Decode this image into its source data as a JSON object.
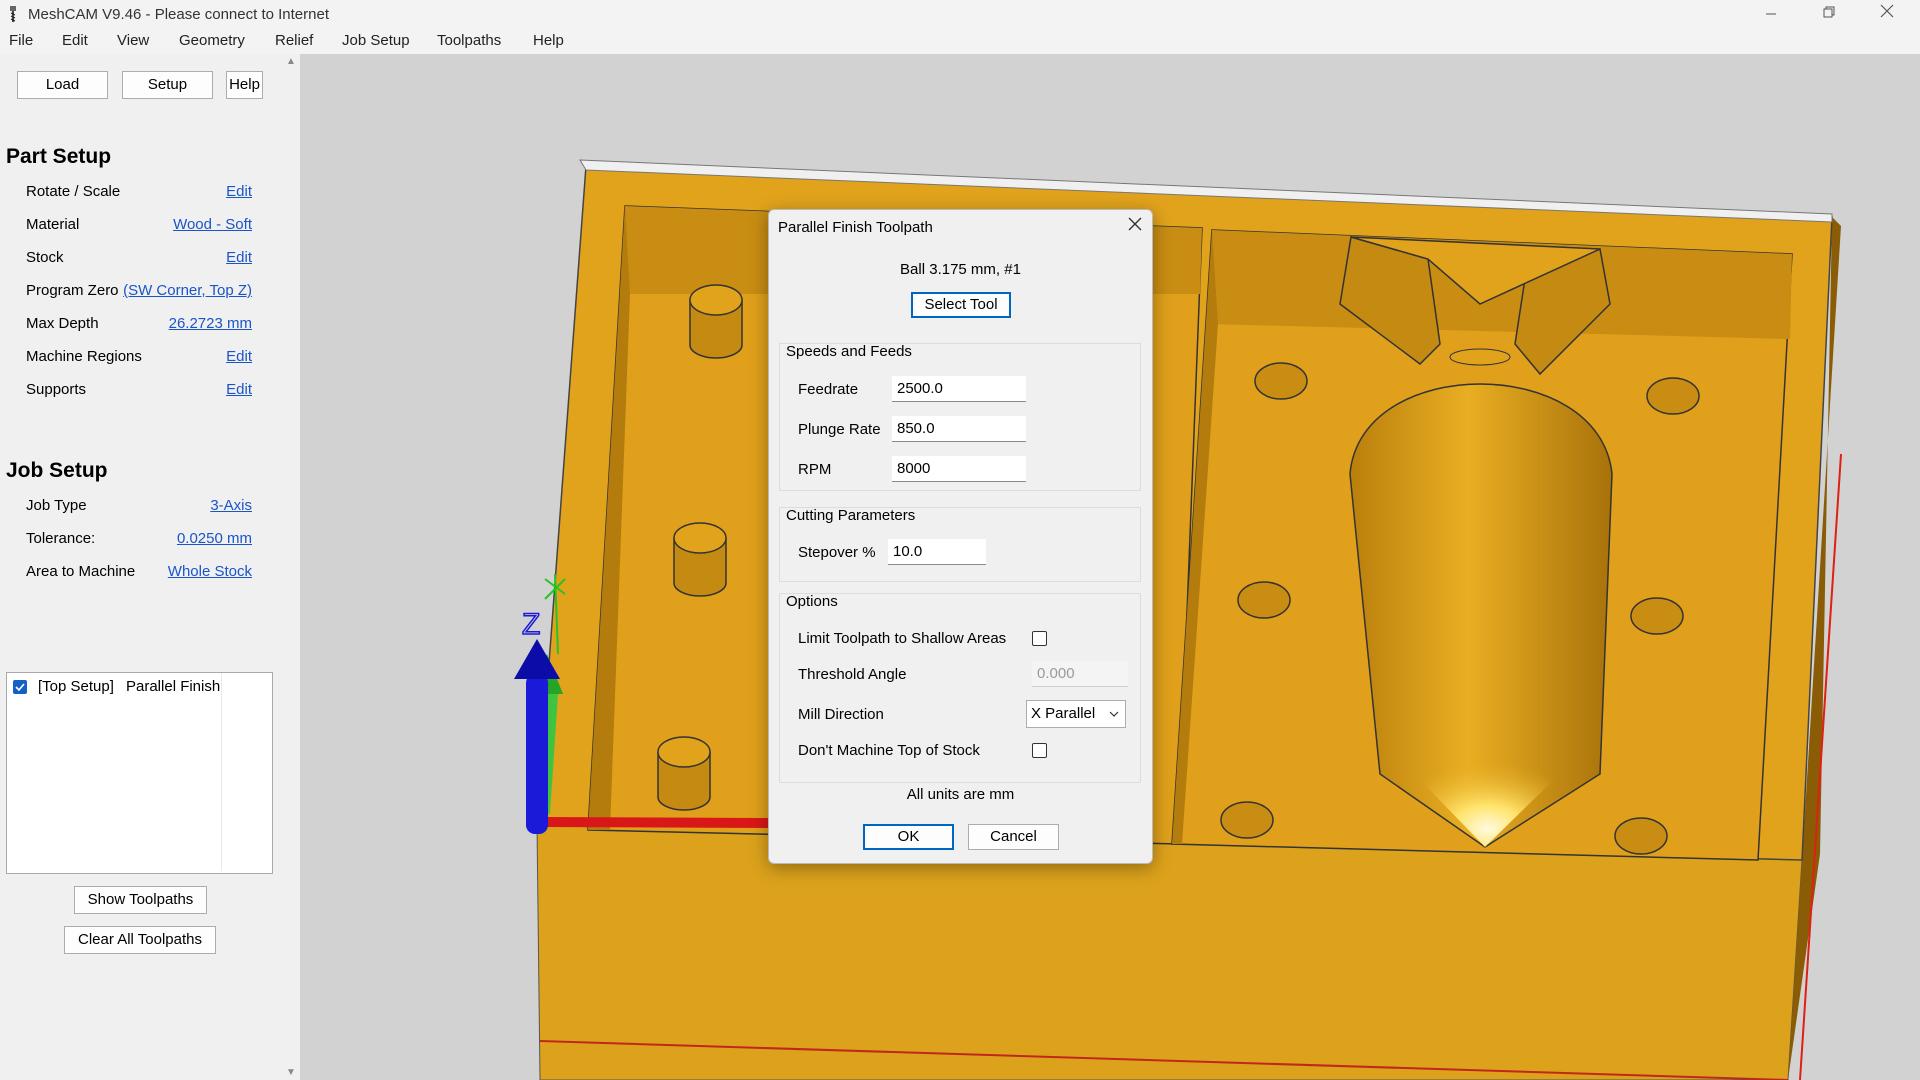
{
  "window": {
    "title": "MeshCAM V9.46 - Please connect to Internet"
  },
  "menu": [
    "File",
    "Edit",
    "View",
    "Geometry",
    "Relief",
    "Job Setup",
    "Toolpaths",
    "Help"
  ],
  "top_buttons": {
    "load": "Load",
    "setup": "Setup",
    "help": "Help"
  },
  "part_setup": {
    "heading": "Part Setup",
    "rows": [
      {
        "label": "Rotate / Scale",
        "value": "Edit"
      },
      {
        "label": "Material",
        "value": "Wood - Soft"
      },
      {
        "label": "Stock",
        "value": "Edit"
      },
      {
        "label": "Program Zero",
        "value": "(SW Corner, Top Z)"
      },
      {
        "label": "Max Depth",
        "value": "26.2723 mm"
      },
      {
        "label": "Machine Regions",
        "value": "Edit"
      },
      {
        "label": "Supports",
        "value": "Edit"
      }
    ]
  },
  "job_setup": {
    "heading": "Job Setup",
    "rows": [
      {
        "label": "Job Type",
        "value": "3-Axis"
      },
      {
        "label": "Tolerance:",
        "value": "0.0250 mm"
      },
      {
        "label": "Area to Machine",
        "value": "Whole Stock"
      }
    ]
  },
  "toolpath_list": [
    {
      "checked": true,
      "setup": "[Top Setup]",
      "name": "Parallel Finish"
    }
  ],
  "bottom_buttons": {
    "show": "Show Toolpaths",
    "clear": "Clear All Toolpaths"
  },
  "viewport": {
    "axis_label": "Z"
  },
  "dialog": {
    "title": "Parallel Finish Toolpath",
    "tool": "Ball 3.175 mm, #1",
    "select_tool": "Select Tool",
    "speeds": {
      "label": "Speeds and Feeds",
      "feedrate_label": "Feedrate",
      "feedrate": "2500.0",
      "plunge_label": "Plunge Rate",
      "plunge": "850.0",
      "rpm_label": "RPM",
      "rpm": "8000"
    },
    "cutting": {
      "label": "Cutting Parameters",
      "stepover_label": "Stepover %",
      "stepover": "10.0"
    },
    "options": {
      "label": "Options",
      "limit_label": "Limit Toolpath to Shallow Areas",
      "limit_checked": false,
      "threshold_label": "Threshold Angle",
      "threshold": "0.000",
      "mill_label": "Mill Direction",
      "mill": "X Parallel",
      "dont_label": "Don't Machine Top of Stock",
      "dont_checked": false
    },
    "units_note": "All units are mm",
    "ok": "OK",
    "cancel": "Cancel"
  },
  "colors": {
    "part": "#e2a31c",
    "link": "#1a55c8",
    "accent": "#0067c0"
  }
}
